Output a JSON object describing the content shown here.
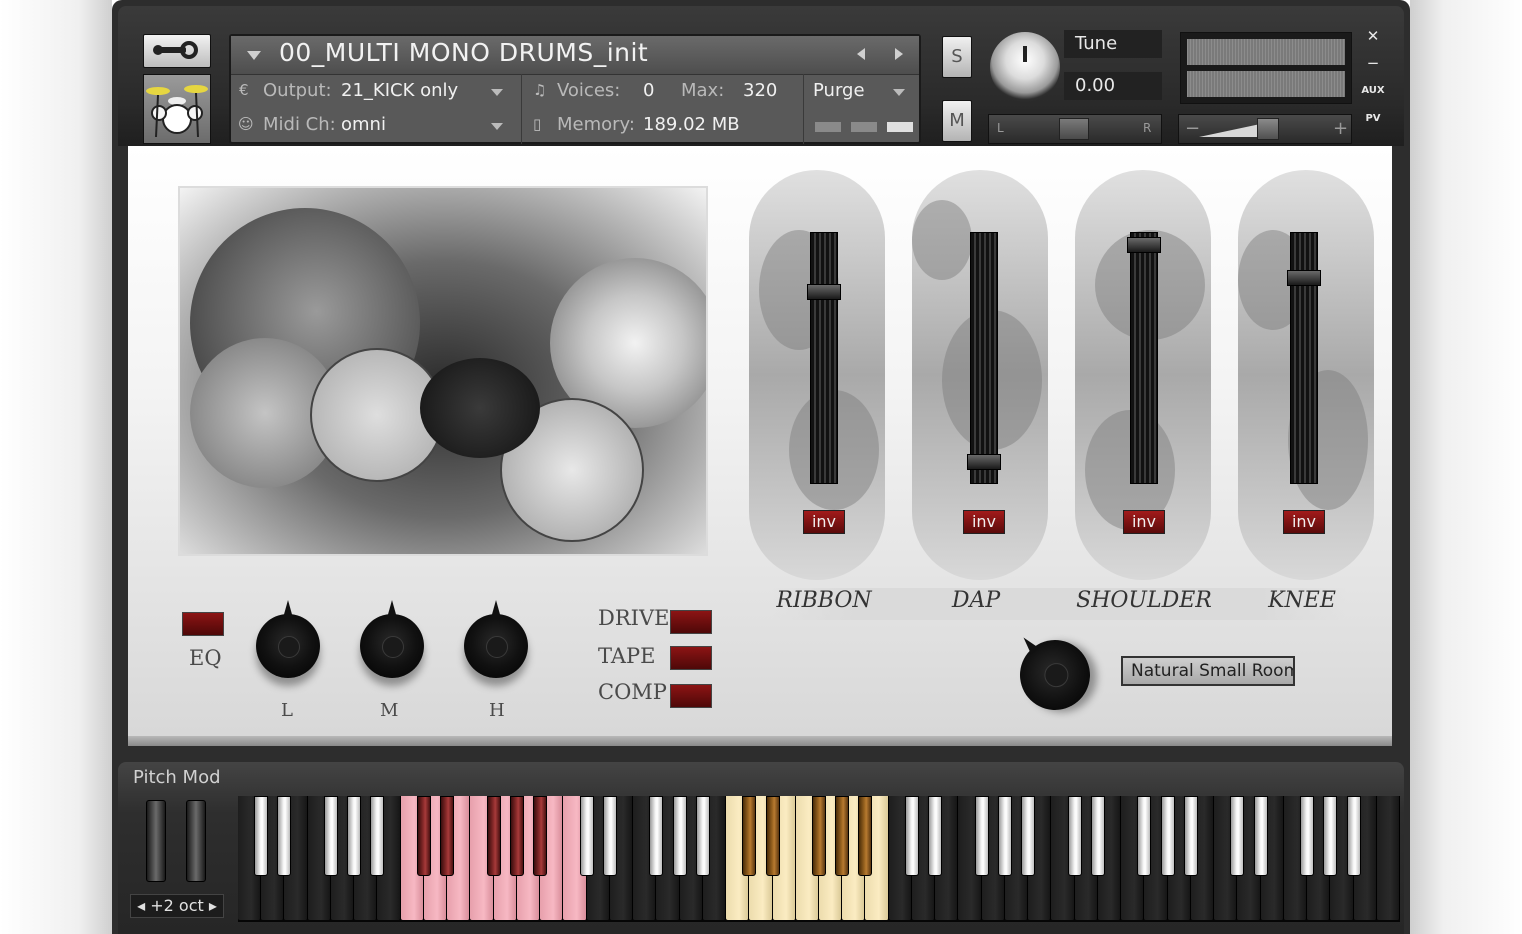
{
  "header": {
    "instrument_title": "00_MULTI MONO DRUMS_init",
    "output_label": "Output:",
    "output_value": "21_KICK only",
    "midi_label": "Midi Ch:",
    "midi_value": "omni",
    "voices_label": "Voices:",
    "voices_value": "0",
    "max_label": "Max:",
    "max_value": "320",
    "purge_label": "Purge",
    "memory_label": "Memory:",
    "memory_value": "189.02 MB",
    "solo_label": "S",
    "mute_label": "M",
    "tune_label": "Tune",
    "tune_value": "0.00",
    "pan_left_label": "L",
    "pan_right_label": "R",
    "volume_minus": "−",
    "volume_plus": "+",
    "close_label": "✕",
    "minimize_label": "−",
    "aux_label": "AUX",
    "pv_label": "PV"
  },
  "mixer": {
    "mics": [
      {
        "name": "RIBBON",
        "inv_label": "inv",
        "level": 0.78
      },
      {
        "name": "DAP",
        "inv_label": "inv",
        "level": 0.06
      },
      {
        "name": "SHOULDER",
        "inv_label": "inv",
        "level": 0.98
      },
      {
        "name": "KNEE",
        "inv_label": "inv",
        "level": 0.84
      }
    ]
  },
  "effects": {
    "eq_label": "EQ",
    "eq_bands": [
      "L",
      "M",
      "H"
    ],
    "drive_label": "DRIVE",
    "tape_label": "TAPE",
    "comp_label": "COMP",
    "reverb_preset": "Natural Small Room"
  },
  "keyboard": {
    "pitch_mod_label": "Pitch Mod",
    "octave_label": "+2 oct"
  },
  "colors": {
    "accent_red": "#8c1414",
    "key_pink": "#f7b8c3",
    "key_yellow": "#fbecc2",
    "panel_bg": "#f4f4f4"
  }
}
